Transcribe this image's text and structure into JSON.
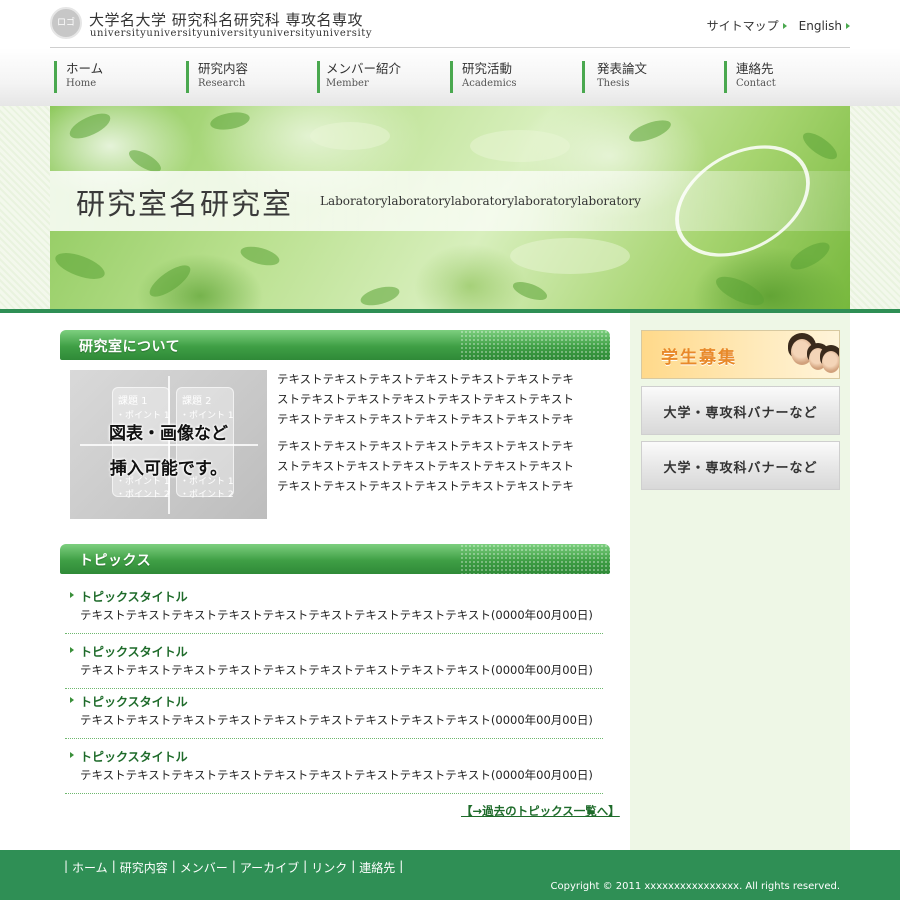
{
  "header": {
    "logo_text": "ロゴ",
    "title": "大学名大学 研究科名研究科 専攻名専攻",
    "subtitle": "universityuniversityuniversityuniversityuniversity",
    "util_links": [
      {
        "label": "サイトマップ"
      },
      {
        "label": "English"
      }
    ]
  },
  "nav": {
    "items": [
      {
        "jp": "ホーム",
        "en": "Home"
      },
      {
        "jp": "研究内容",
        "en": "Research"
      },
      {
        "jp": "メンバー紹介",
        "en": "Member"
      },
      {
        "jp": "研究活動",
        "en": "Academics"
      },
      {
        "jp": "発表論文",
        "en": "Thesis"
      },
      {
        "jp": "連絡先",
        "en": "Contact"
      }
    ]
  },
  "hero": {
    "title": "研究室名研究室",
    "subtitle": "Laboratorylaboratorylaboratorylaboratorylaboratory"
  },
  "about": {
    "heading": "研究室について",
    "figure": {
      "topic1": "課題 1",
      "topic2": "課題 2",
      "point1": "・ポイント 1",
      "point2": "・ポイント 2",
      "line1": "図表・画像など",
      "line2": "挿入可能です。"
    },
    "paragraphs": [
      "テキストテキストテキストテキストテキストテキストテキストテキストテキストテキストテキストテキストテキストテキストテキストテキストテキストテキストテキストテキストテキス",
      "テキストテキストテキストテキストテキストテキストテキストテキストテキストテキストテキストテキストテキストテキストテキストテキストテキストテキストテキストテキストテキス"
    ]
  },
  "topics": {
    "heading": "トピックス",
    "items": [
      {
        "title": "トピックスタイトル",
        "body": "テキストテキストテキストテキストテキストテキストテキストテキストテキスト(0000年00月00日)"
      },
      {
        "title": "トピックスタイトル",
        "body": "テキストテキストテキストテキストテキストテキストテキストテキストテキスト(0000年00月00日)"
      },
      {
        "title": "トピックスタイトル",
        "body": "テキストテキストテキストテキストテキストテキストテキストテキストテキスト(0000年00月00日)"
      },
      {
        "title": "トピックスタイトル",
        "body": "テキストテキストテキストテキストテキストテキストテキストテキストテキスト(0000年00月00日)"
      }
    ],
    "more_link": "【→過去のトピックス一覧へ】"
  },
  "sidebar": {
    "recruit_label": "学生募集",
    "banners": [
      {
        "label": "大学・専攻科バナーなど"
      },
      {
        "label": "大学・専攻科バナーなど"
      }
    ]
  },
  "footer": {
    "links": [
      "ホーム",
      "研究内容",
      "メンバー",
      "アーカイブ",
      "リンク",
      "連絡先"
    ],
    "copyright": "Copyright © 2011 xxxxxxxxxxxxxxxx. All rights reserved."
  },
  "colors": {
    "brand_green": "#2f8f55",
    "accent_green": "#4aa84f",
    "recruit_orange": "#e8892a"
  }
}
